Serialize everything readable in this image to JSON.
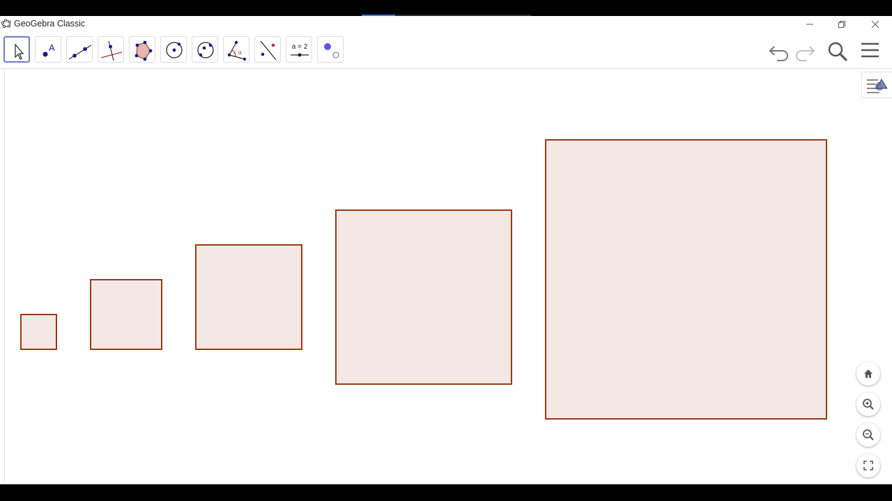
{
  "window": {
    "title": "GeoGebra Classic",
    "controls": [
      "minimize-icon",
      "restore-icon",
      "close-icon"
    ]
  },
  "toolbar": {
    "tools": [
      {
        "name": "move-tool",
        "icon": "arrow-pointer-icon",
        "active": true
      },
      {
        "name": "point-tool",
        "icon": "point-icon",
        "label": "A"
      },
      {
        "name": "line-tool",
        "icon": "line-icon"
      },
      {
        "name": "perpendicular-line-tool",
        "icon": "perpendicular-icon"
      },
      {
        "name": "polygon-tool",
        "icon": "polygon-icon"
      },
      {
        "name": "circle-tool",
        "icon": "circle-icon"
      },
      {
        "name": "circle-three-points-tool",
        "icon": "circle-3pts-icon"
      },
      {
        "name": "angle-tool",
        "icon": "angle-icon",
        "label": "α"
      },
      {
        "name": "reflect-tool",
        "icon": "reflect-icon"
      },
      {
        "name": "slider-tool",
        "icon": "slider-icon",
        "label": "a = 2"
      },
      {
        "name": "show-hide-tool",
        "icon": "show-hide-object-icon"
      }
    ],
    "right": [
      "undo-icon",
      "redo-icon",
      "search-icon",
      "menu-icon"
    ]
  },
  "graphics": {
    "squares": [
      {
        "side_units": 1
      },
      {
        "side_units": 2
      },
      {
        "side_units": 3
      },
      {
        "side_units": 5
      },
      {
        "side_units": 8
      }
    ],
    "fill_color": "#f4e8e5",
    "stroke_color": "#9a3a10"
  },
  "nav_buttons": [
    "home-icon",
    "zoom-in-icon",
    "zoom-out-icon",
    "fullscreen-icon"
  ],
  "colors": {
    "accent": "#6a7fc1",
    "point_blue": "#1a1a8c"
  }
}
